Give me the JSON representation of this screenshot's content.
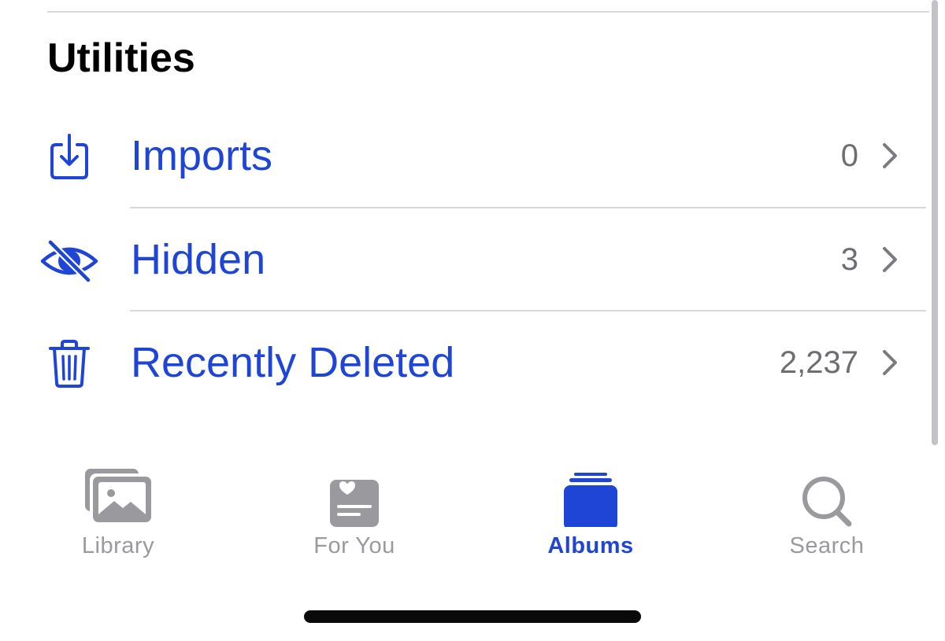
{
  "section": {
    "title": "Utilities"
  },
  "utilities": [
    {
      "label": "Imports",
      "count": "0",
      "icon": "import-tray-icon"
    },
    {
      "label": "Hidden",
      "count": "3",
      "icon": "eye-slash-icon"
    },
    {
      "label": "Recently Deleted",
      "count": "2,237",
      "icon": "trash-icon"
    }
  ],
  "tabbar": {
    "tabs": [
      {
        "label": "Library",
        "icon": "photo-library-icon",
        "selected": false
      },
      {
        "label": "For You",
        "icon": "for-you-icon",
        "selected": false
      },
      {
        "label": "Albums",
        "icon": "albums-icon",
        "selected": true
      },
      {
        "label": "Search",
        "icon": "search-icon",
        "selected": false
      }
    ]
  },
  "colors": {
    "accent": "#1f45d6",
    "count_text": "#6d6d72",
    "inactive_tab": "#9a9a9e",
    "divider": "#d8d8dc"
  }
}
